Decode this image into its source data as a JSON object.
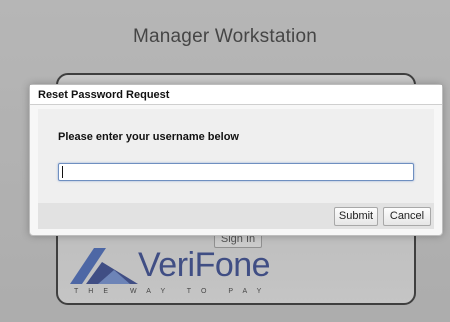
{
  "background": {
    "title": "Manager Workstation",
    "sign_in_label": "Sign In",
    "logo": {
      "name": "VeriFone",
      "tagline": "THE WAY TO PAY"
    }
  },
  "dialog": {
    "title": "Reset Password Request",
    "prompt": "Please enter your username below",
    "username": {
      "value": "",
      "placeholder": ""
    },
    "submit_label": "Submit",
    "cancel_label": "Cancel"
  },
  "colors": {
    "brand_blue": "#2c3f8a",
    "input_focus": "#6f8fc0"
  },
  "icons": {
    "logo_mark": "verifone-logo-icon"
  }
}
